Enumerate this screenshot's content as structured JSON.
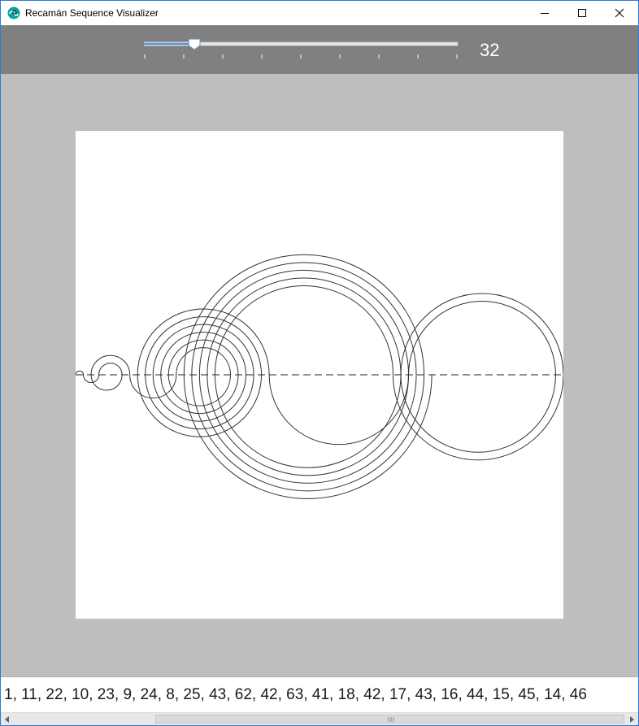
{
  "window": {
    "title": "Recamán Sequence Visualizer",
    "icon": "recaman-app-icon",
    "controls": [
      "minimize-icon",
      "maximize-icon",
      "close-icon"
    ]
  },
  "toolbar": {
    "slider_value": "32",
    "slider_level": 0.16,
    "slider_tick_count": 9
  },
  "sequence": {
    "visible_text": "1, 11, 22, 10, 23, 9, 24, 8, 25, 43, 62, 42, 63, 41, 18, 42, 17, 43, 16, 44, 15, 45, 14, 46"
  },
  "colors": {
    "toolbar": "#808080",
    "background": "#bebebe",
    "canvas": "#ffffff",
    "stroke": "#333333"
  }
}
